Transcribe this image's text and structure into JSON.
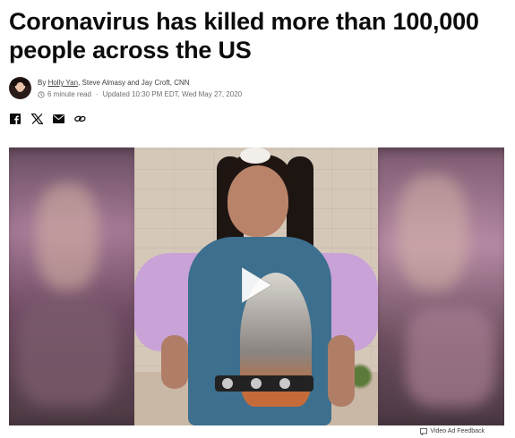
{
  "article": {
    "headline": "Coronavirus has killed more than 100,000 people across the US",
    "byline_prefix": "By ",
    "author_primary": "Holly Yan",
    "authors_rest": ", Steve Almasy and Jay Croft, CNN",
    "read_time": "6 minute read",
    "separator": "·",
    "updated": "Updated 10:30 PM EDT, Wed May 27, 2020"
  },
  "share": {
    "icons": [
      "facebook-icon",
      "x-icon",
      "email-icon",
      "link-icon"
    ]
  },
  "video": {
    "ad_feedback_label": "Video Ad Feedback"
  },
  "colors": {
    "headline": "#0c0c0c",
    "meta": "#6e6e6e",
    "accent_border": "#cc0000"
  }
}
